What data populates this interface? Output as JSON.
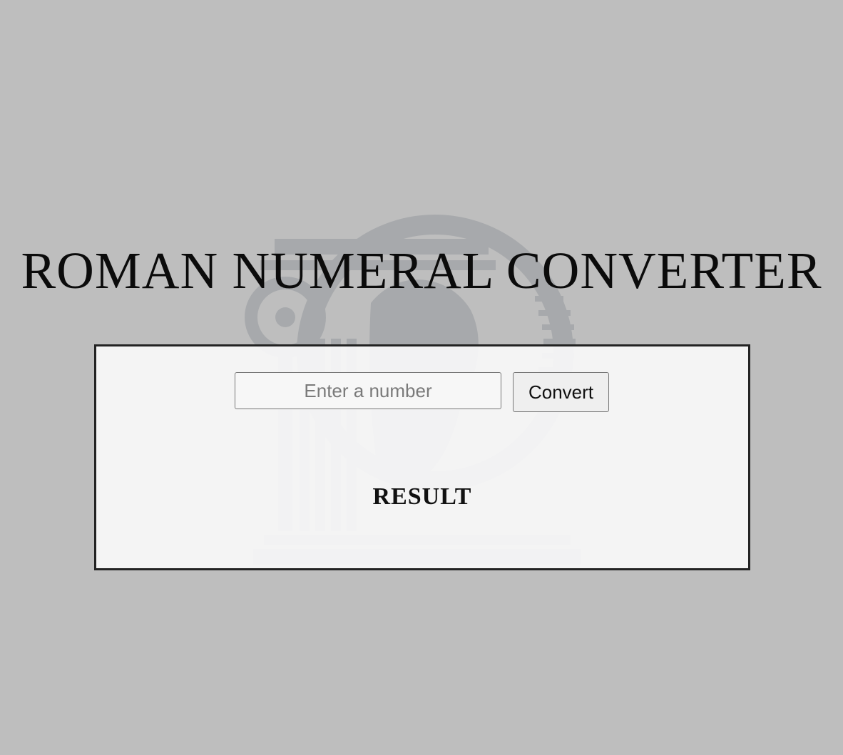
{
  "page": {
    "title": "ROMAN NUMERAL CONVERTER"
  },
  "converter": {
    "input_placeholder": "Enter a number",
    "input_value": "",
    "convert_label": "Convert",
    "result_text": "RESULT"
  },
  "theme": {
    "background": "#bebebe",
    "panel_background": "#f8f8f8",
    "panel_border": "#232323"
  },
  "watermark": {
    "icon": "ionic-column-profile-icon"
  }
}
